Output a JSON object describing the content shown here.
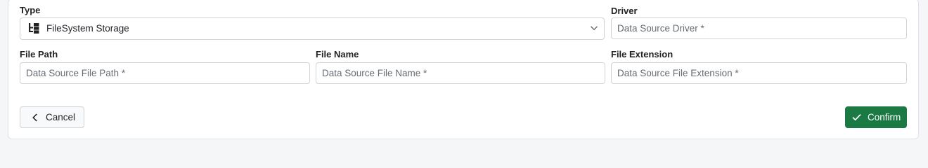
{
  "form": {
    "type": {
      "label": "Type",
      "value": "FileSystem Storage",
      "icon": "filesystem-tree-icon"
    },
    "driver": {
      "label": "Driver",
      "placeholder": "Data Source Driver *"
    },
    "file_path": {
      "label": "File Path",
      "placeholder": "Data Source File Path *"
    },
    "file_name": {
      "label": "File Name",
      "placeholder": "Data Source File Name *"
    },
    "file_extension": {
      "label": "File Extension",
      "placeholder": "Data Source File Extension *"
    }
  },
  "actions": {
    "cancel_label": "Cancel",
    "confirm_label": "Confirm"
  },
  "colors": {
    "confirm": "#1b7a43",
    "border": "#ced4da"
  }
}
